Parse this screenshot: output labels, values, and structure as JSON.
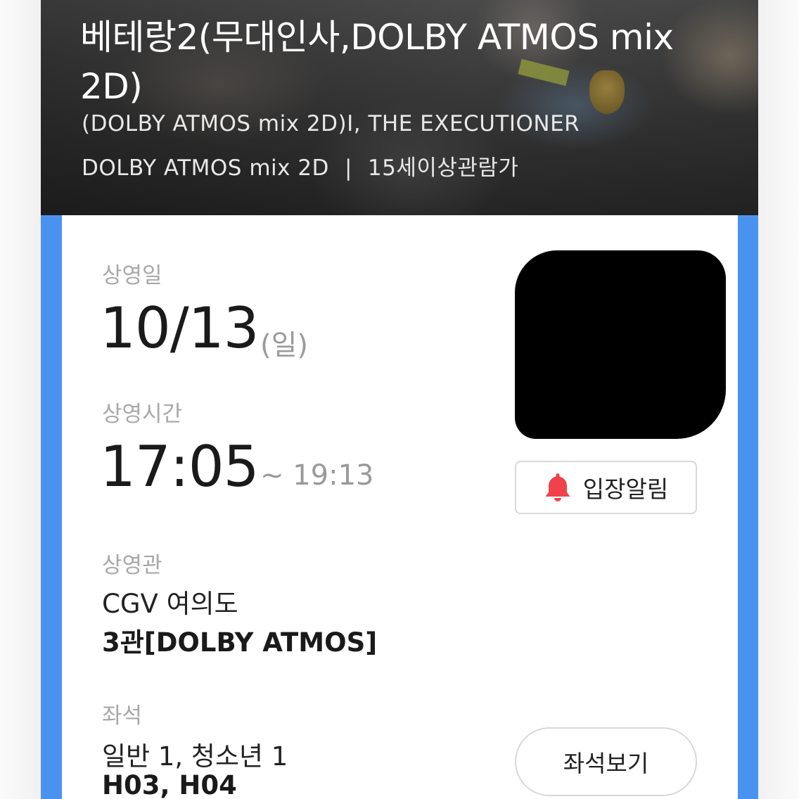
{
  "header": {
    "title": "베테랑2(무대인사,DOLBY ATMOS mix 2D)",
    "subtitle": "(DOLBY ATMOS mix 2D)I, THE EXECUTIONER",
    "format": "DOLBY ATMOS mix 2D",
    "separator": "|",
    "rating": "15세이상관람가"
  },
  "schedule": {
    "date_label": "상영일",
    "date_value": "10/13",
    "weekday": "(일)",
    "time_label": "상영시간",
    "start_time": "17:05",
    "end_time": "~ 19:13"
  },
  "theater": {
    "label": "상영관",
    "cinema": "CGV 여의도",
    "screen": "3관[DOLBY ATMOS]"
  },
  "seats": {
    "label": "좌석",
    "types": "일반 1, 청소년 1",
    "numbers": "H03, H04"
  },
  "buttons": {
    "alarm_label": "입장알림",
    "seat_view_label": "좌석보기"
  },
  "icons": {
    "alarm_icon": "bell-icon"
  },
  "colors": {
    "frame_blue": "#4a92f0",
    "bell_red": "#f0424a"
  }
}
